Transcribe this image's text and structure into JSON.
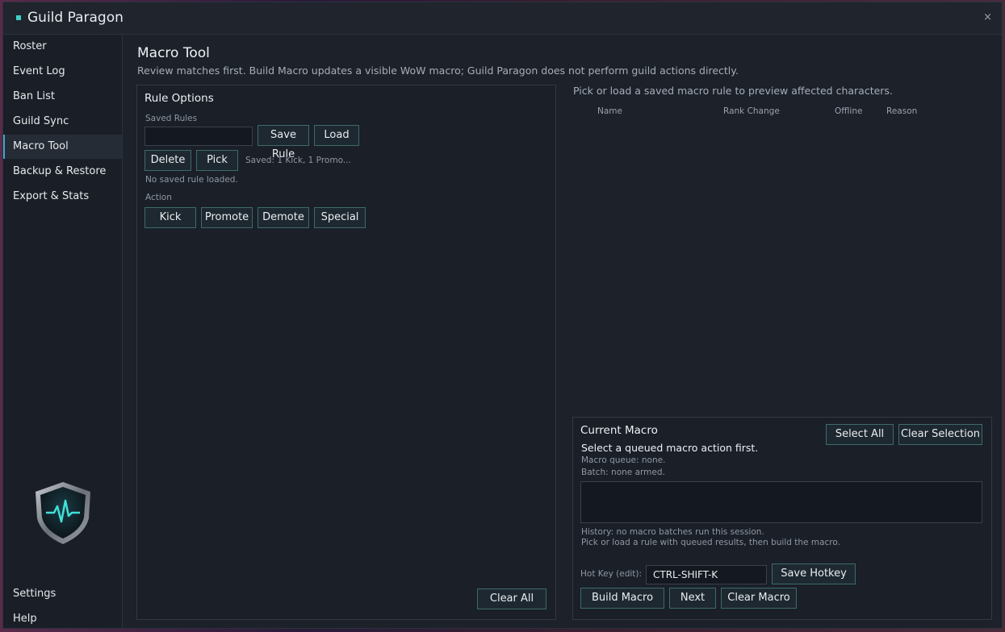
{
  "window": {
    "title": "Guild Paragon",
    "close_glyph": "×"
  },
  "sidebar": {
    "items": [
      {
        "label": "Roster"
      },
      {
        "label": "Event Log"
      },
      {
        "label": "Ban List"
      },
      {
        "label": "Guild Sync"
      },
      {
        "label": "Macro Tool"
      },
      {
        "label": "Backup & Restore"
      },
      {
        "label": "Export & Stats"
      }
    ],
    "active": "Macro Tool",
    "bottom": [
      {
        "label": "Settings"
      },
      {
        "label": "Help"
      }
    ],
    "logo_icon": "shield-heartbeat-icon"
  },
  "page": {
    "title": "Macro Tool",
    "subtitle": "Review matches first. Build Macro updates a visible WoW macro; Guild Paragon does not perform guild actions directly."
  },
  "rule_options": {
    "title": "Rule Options",
    "saved_rules_label": "Saved Rules",
    "saved_rules_value": "",
    "save_rule": "Save Rule",
    "load": "Load",
    "delete": "Delete",
    "pick": "Pick",
    "saved_summary": "Saved: 1 Kick, 1 Promo...",
    "status": "No saved rule loaded.",
    "action_label": "Action",
    "actions": {
      "kick": "Kick",
      "promote": "Promote",
      "demote": "Demote",
      "special": "Special"
    },
    "clear_all": "Clear All"
  },
  "preview": {
    "hint": "Pick or load a saved macro rule to preview affected characters.",
    "columns": {
      "name": "Name",
      "rank_change": "Rank Change",
      "offline": "Offline",
      "reason": "Reason"
    }
  },
  "current_macro": {
    "title": "Current Macro",
    "select_all": "Select All",
    "clear_selection": "Clear Selection",
    "instruction": "Select a queued macro action first.",
    "queue": "Macro queue: none.",
    "batch": "Batch: none armed.",
    "body": "",
    "history": "History: no macro batches run this session.",
    "hint": "Pick or load a rule with queued results, then build the macro.",
    "hotkey_label": "Hot Key (edit):",
    "hotkey_value": "CTRL-SHIFT-K",
    "save_hotkey": "Save Hotkey",
    "build_macro": "Build Macro",
    "next": "Next",
    "clear_macro": "Clear Macro"
  },
  "colors": {
    "accent": "#3fd0c4",
    "button_border": "#3d6b6a",
    "background": "#1c212a"
  }
}
